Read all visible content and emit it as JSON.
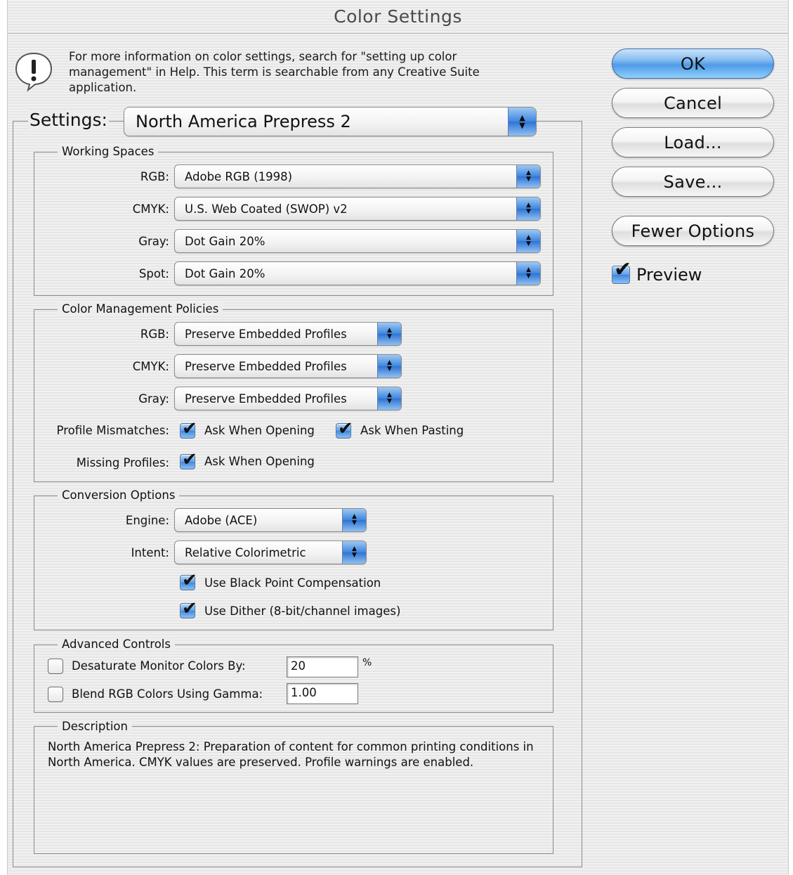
{
  "window": {
    "title": "Color Settings"
  },
  "info": {
    "text": "For more information on color settings, search for \"setting up color management\" in Help. This term is searchable from any Creative Suite application."
  },
  "settings": {
    "label": "Settings:",
    "value": "North America Prepress 2"
  },
  "working_spaces": {
    "title": "Working Spaces",
    "rows": [
      {
        "label": "RGB:",
        "value": "Adobe RGB (1998)"
      },
      {
        "label": "CMYK:",
        "value": "U.S. Web Coated (SWOP) v2"
      },
      {
        "label": "Gray:",
        "value": "Dot Gain 20%"
      },
      {
        "label": "Spot:",
        "value": "Dot Gain 20%"
      }
    ]
  },
  "policies": {
    "title": "Color Management Policies",
    "rows": [
      {
        "label": "RGB:",
        "value": "Preserve Embedded Profiles"
      },
      {
        "label": "CMYK:",
        "value": "Preserve Embedded Profiles"
      },
      {
        "label": "Gray:",
        "value": "Preserve Embedded Profiles"
      }
    ],
    "profile_mismatches": {
      "label": "Profile Mismatches:",
      "ask_opening": "Ask When Opening",
      "ask_opening_checked": true,
      "ask_pasting": "Ask When Pasting",
      "ask_pasting_checked": true
    },
    "missing_profiles": {
      "label": "Missing Profiles:",
      "ask_opening": "Ask When Opening",
      "ask_opening_checked": true
    }
  },
  "conversion": {
    "title": "Conversion Options",
    "engine_label": "Engine:",
    "engine_value": "Adobe (ACE)",
    "intent_label": "Intent:",
    "intent_value": "Relative Colorimetric",
    "black_point": "Use Black Point Compensation",
    "black_point_checked": true,
    "dither": "Use Dither (8-bit/channel images)",
    "dither_checked": true
  },
  "advanced": {
    "title": "Advanced Controls",
    "desaturate_label": "Desaturate Monitor Colors By:",
    "desaturate_checked": false,
    "desaturate_value": "20",
    "desaturate_unit": "%",
    "blend_label": "Blend RGB Colors Using Gamma:",
    "blend_checked": false,
    "blend_value": "1.00"
  },
  "description": {
    "title": "Description",
    "text": "North America Prepress 2:  Preparation of content for common printing conditions in North America. CMYK values are preserved. Profile warnings are enabled."
  },
  "buttons": {
    "ok": "OK",
    "cancel": "Cancel",
    "load": "Load...",
    "save": "Save...",
    "fewer_options": "Fewer Options"
  },
  "preview": {
    "label": "Preview",
    "checked": true
  },
  "icons": {
    "alert": "alert-icon",
    "popup_arrows": "popup-arrows-icon",
    "check": "checkmark-icon"
  }
}
